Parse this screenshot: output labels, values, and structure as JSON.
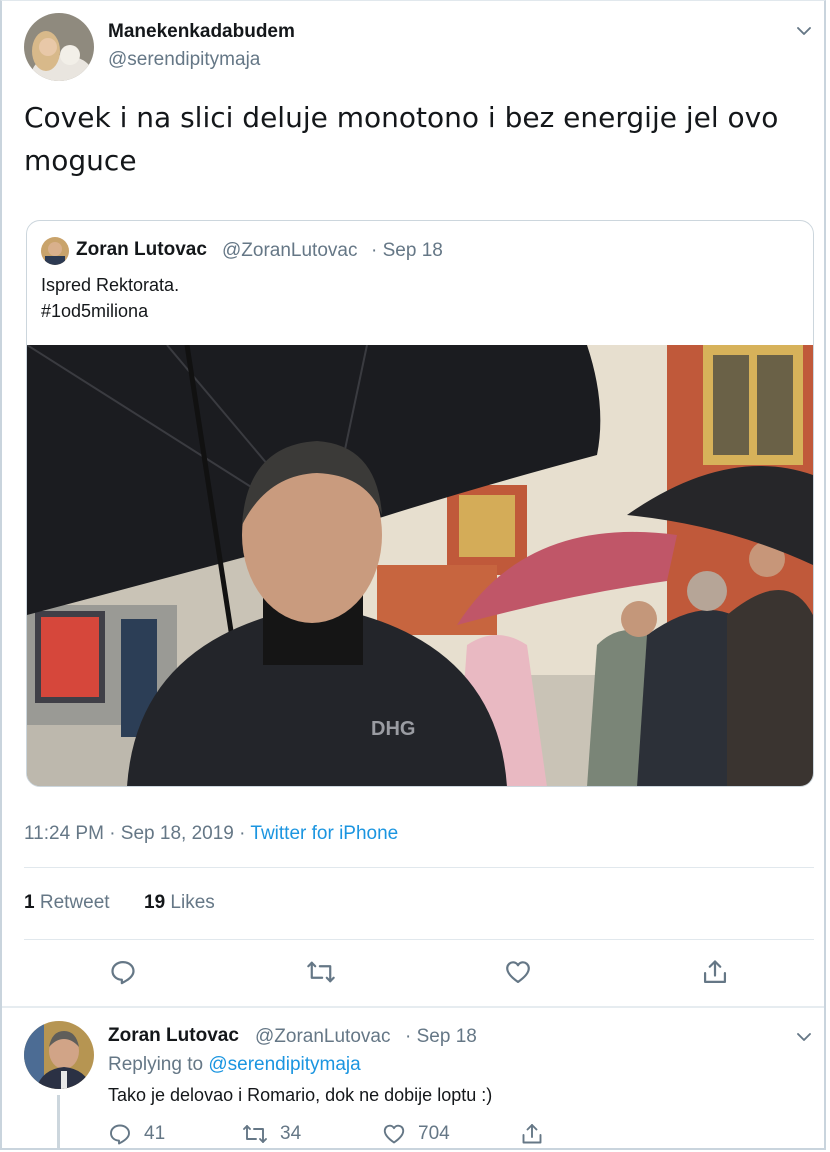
{
  "tweet": {
    "display_name": "Manekenkadabudem",
    "handle": "@serendipitymaja",
    "text_line1": "Covek i na slici deluje monotono i bez energije jel ovo",
    "text_line2": "moguce",
    "timestamp": "11:24 PM · Sep 18, 2019 · ",
    "source": "Twitter for iPhone",
    "retweet_count": "1",
    "retweet_label": "Retweet",
    "like_count": "19",
    "like_label": "Likes"
  },
  "quoted": {
    "display_name": "Zoran Lutovac",
    "handle": "@ZoranLutovac",
    "date": "· Sep 18",
    "text_line1": "Ispred Rektorata.",
    "text_line2": "#1od5miliona",
    "jacket_text": "DHG"
  },
  "reply": {
    "display_name": "Zoran Lutovac",
    "handle": "@ZoranLutovac",
    "date": "· Sep 18",
    "replying_prefix": "Replying to ",
    "replying_to": "@serendipitymaja",
    "text": "Tako je delovao i Romario, dok ne dobije loptu :)",
    "reply_count": "41",
    "retweet_count": "34",
    "like_count": "704"
  },
  "icons": [
    "chevron-down-icon",
    "reply-icon",
    "retweet-icon",
    "like-icon",
    "share-icon"
  ],
  "colors": {
    "link": "#1b95e0",
    "muted": "#657786",
    "text": "#14171a",
    "divider": "#e1e8ed"
  }
}
